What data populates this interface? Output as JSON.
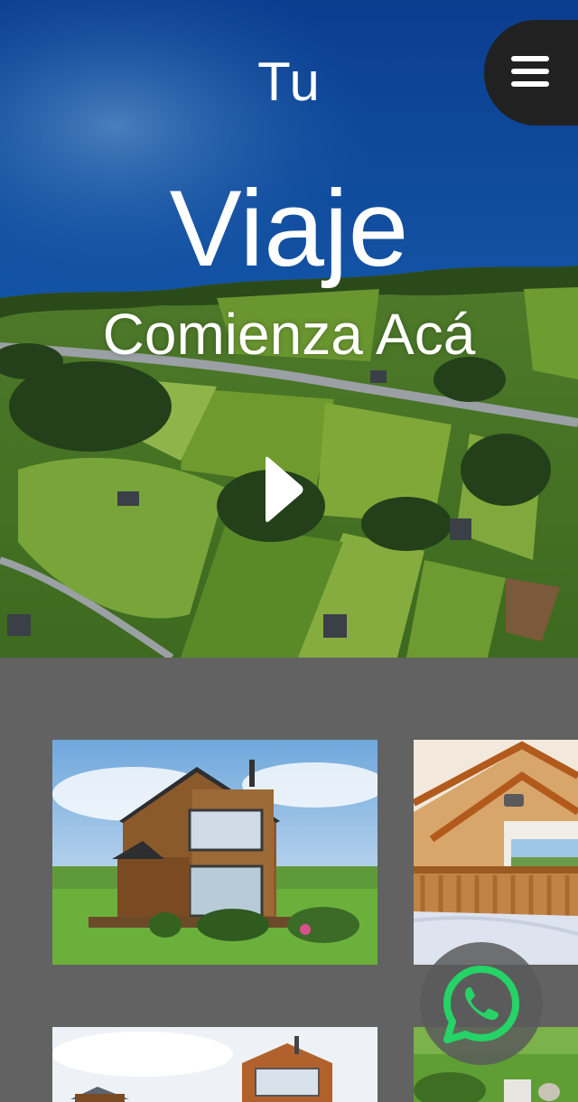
{
  "hero": {
    "line1": "Tu",
    "line2": "Viaje",
    "line3": "Comienza Acá"
  },
  "icons": {
    "menu": "hamburger-menu-icon",
    "play": "play-icon",
    "whatsapp": "whatsapp-icon"
  },
  "gallery": {
    "photos": [
      {
        "subject": "wooden-cabin-exterior"
      },
      {
        "subject": "cabin-loft-bedroom-interior"
      },
      {
        "subject": "cabin-exterior-front"
      },
      {
        "subject": "garden-table"
      }
    ]
  },
  "colors": {
    "background": "#626262",
    "menu_button": "#212121",
    "whatsapp_green": "#25d366",
    "text": "#ffffff"
  }
}
